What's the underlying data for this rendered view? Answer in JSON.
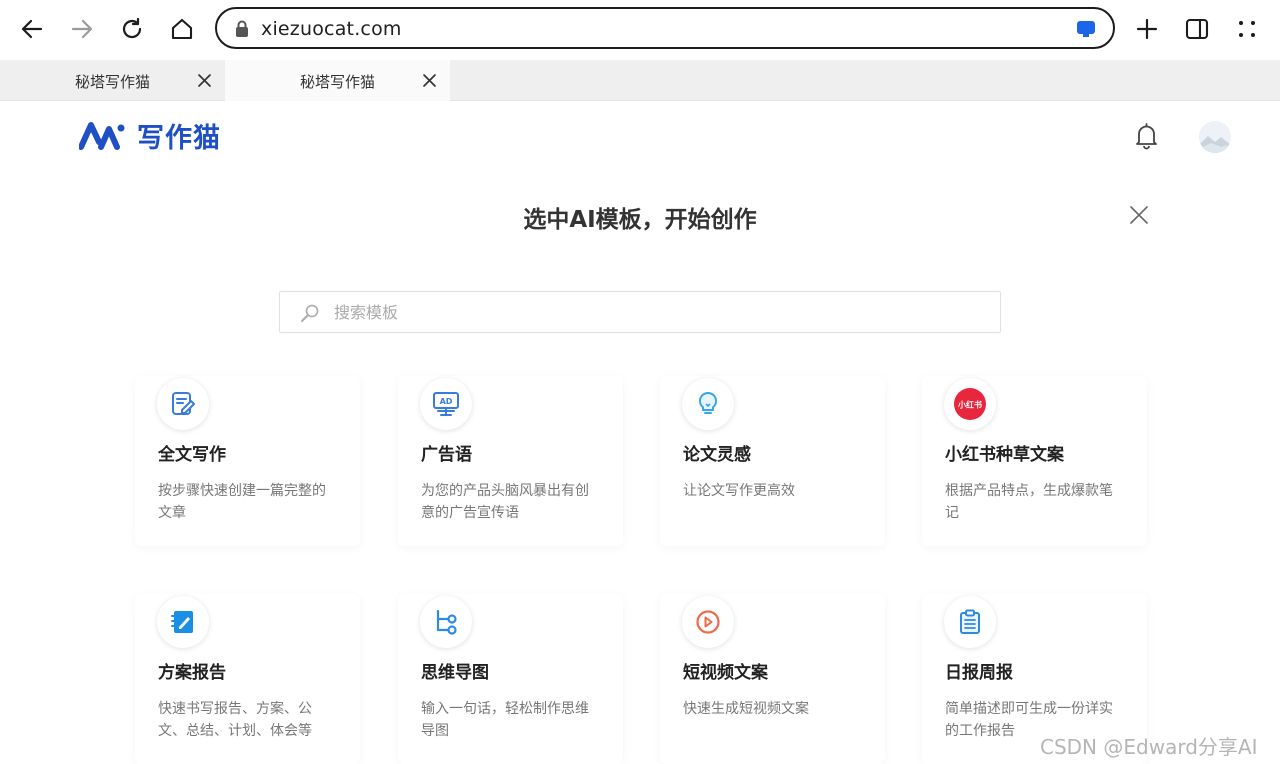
{
  "browser": {
    "url": "xiezuocat.com",
    "tabs": [
      {
        "title": "秘塔写作猫"
      },
      {
        "title": "秘塔写作猫"
      }
    ],
    "icons": [
      "back-icon",
      "forward-icon",
      "reload-icon",
      "home-icon",
      "lock-icon",
      "extension-icon",
      "new-tab-icon",
      "side-panel-icon",
      "menu-icon"
    ]
  },
  "header": {
    "logo_text": "写作猫",
    "brand_color": "#1e4fc4"
  },
  "modal": {
    "title": "选中AI模板，开始创作",
    "search_placeholder": "搜索模板",
    "cards": [
      {
        "title": "全文写作",
        "desc": "按步骤快速创建一篇完整的文章",
        "icon": "edit-document-icon"
      },
      {
        "title": "广告语",
        "desc": "为您的产品头脑风暴出有创意的广告宣传语",
        "icon": "ad-billboard-icon"
      },
      {
        "title": "论文灵感",
        "desc": "让论文写作更高效",
        "icon": "lightbulb-icon"
      },
      {
        "title": "小红书种草文案",
        "desc": "根据产品特点，生成爆款笔记",
        "icon": "xiaohongshu-icon",
        "badge": "小红书"
      },
      {
        "title": "方案报告",
        "desc": "快速书写报告、方案、公文、总结、计划、体会等",
        "icon": "notebook-pen-icon"
      },
      {
        "title": "思维导图",
        "desc": "输入一句话，轻松制作思维导图",
        "icon": "mind-map-icon"
      },
      {
        "title": "短视频文案",
        "desc": "快速生成短视频文案",
        "icon": "video-play-icon"
      },
      {
        "title": "日报周报",
        "desc": "简单描述即可生成一份详实的工作报告",
        "icon": "clipboard-list-icon"
      }
    ]
  },
  "watermark": "CSDN @Edward分享AI"
}
